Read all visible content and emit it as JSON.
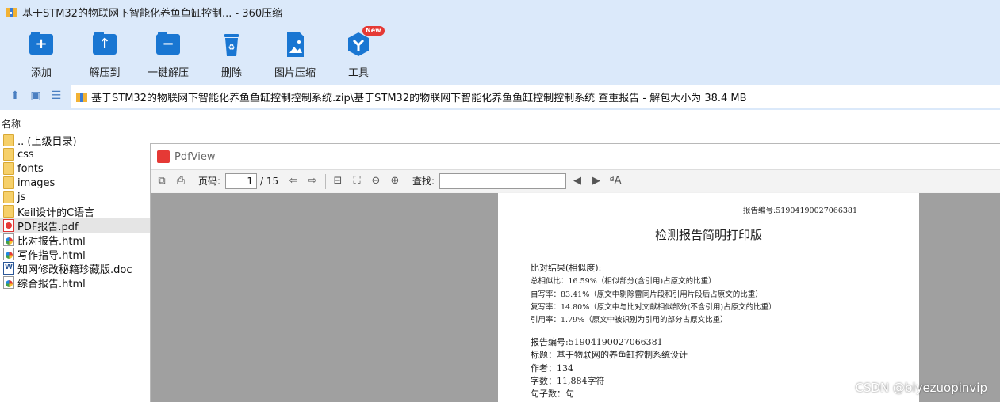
{
  "window": {
    "title": "基于STM32的物联网下智能化养鱼鱼缸控制... - 360压缩"
  },
  "toolbar": {
    "items": [
      {
        "label": "添加",
        "icon": "add-icon"
      },
      {
        "label": "解压到",
        "icon": "extract-to-icon"
      },
      {
        "label": "一键解压",
        "icon": "one-click-extract-icon"
      },
      {
        "label": "删除",
        "icon": "delete-icon"
      },
      {
        "label": "图片压缩",
        "icon": "image-compress-icon"
      },
      {
        "label": "工具",
        "icon": "tools-icon",
        "badge": "New"
      }
    ],
    "accent": "#1976d2"
  },
  "address": {
    "path": "基于STM32的物联网下智能化养鱼鱼缸控制控制系统.zip\\基于STM32的物联网下智能化养鱼鱼缸控制控制系统 查重报告 - 解包大小为 38.4 MB"
  },
  "filelist": {
    "column_header": "名称",
    "items": [
      {
        "name": ".. (上级目录)",
        "type": "folder"
      },
      {
        "name": "css",
        "type": "folder"
      },
      {
        "name": "fonts",
        "type": "folder"
      },
      {
        "name": "images",
        "type": "folder"
      },
      {
        "name": "js",
        "type": "folder"
      },
      {
        "name": "Keil设计的C语言",
        "type": "folder"
      },
      {
        "name": "PDF报告.pdf",
        "type": "pdf",
        "selected": true
      },
      {
        "name": "比对报告.html",
        "type": "html"
      },
      {
        "name": "写作指导.html",
        "type": "html"
      },
      {
        "name": "知网修改秘籍珍藏版.doc",
        "type": "doc"
      },
      {
        "name": "综合报告.html",
        "type": "html"
      }
    ]
  },
  "pdfview": {
    "title": "PdfView",
    "page_label": "页码:",
    "current_page": "1",
    "total_pages": "/ 15",
    "find_label": "查找:",
    "find_value": ""
  },
  "document": {
    "report_no_top": "报告编号:51904190027066381",
    "title": "检测报告简明打印版",
    "lines": [
      "比对结果(相似度):",
      "总相似比：16.59%（相似部分(含引用)占原文的比重）",
      "自写率：83.41%（原文中剔除雷同片段和引用片段后占原文的比重）",
      "复写率：14.80%（原文中与比对文献相似部分(不含引用)占原文的比重）",
      "引用率：1.79%（原文中被识别为引用的部分占原文比重）",
      "报告编号:51904190027066381",
      "标题：基于物联网的养鱼缸控制系统设计",
      "作者：134",
      "字数：11,884字符",
      "句子数：句"
    ]
  },
  "watermark": "CSDN @biyezuopinvip"
}
